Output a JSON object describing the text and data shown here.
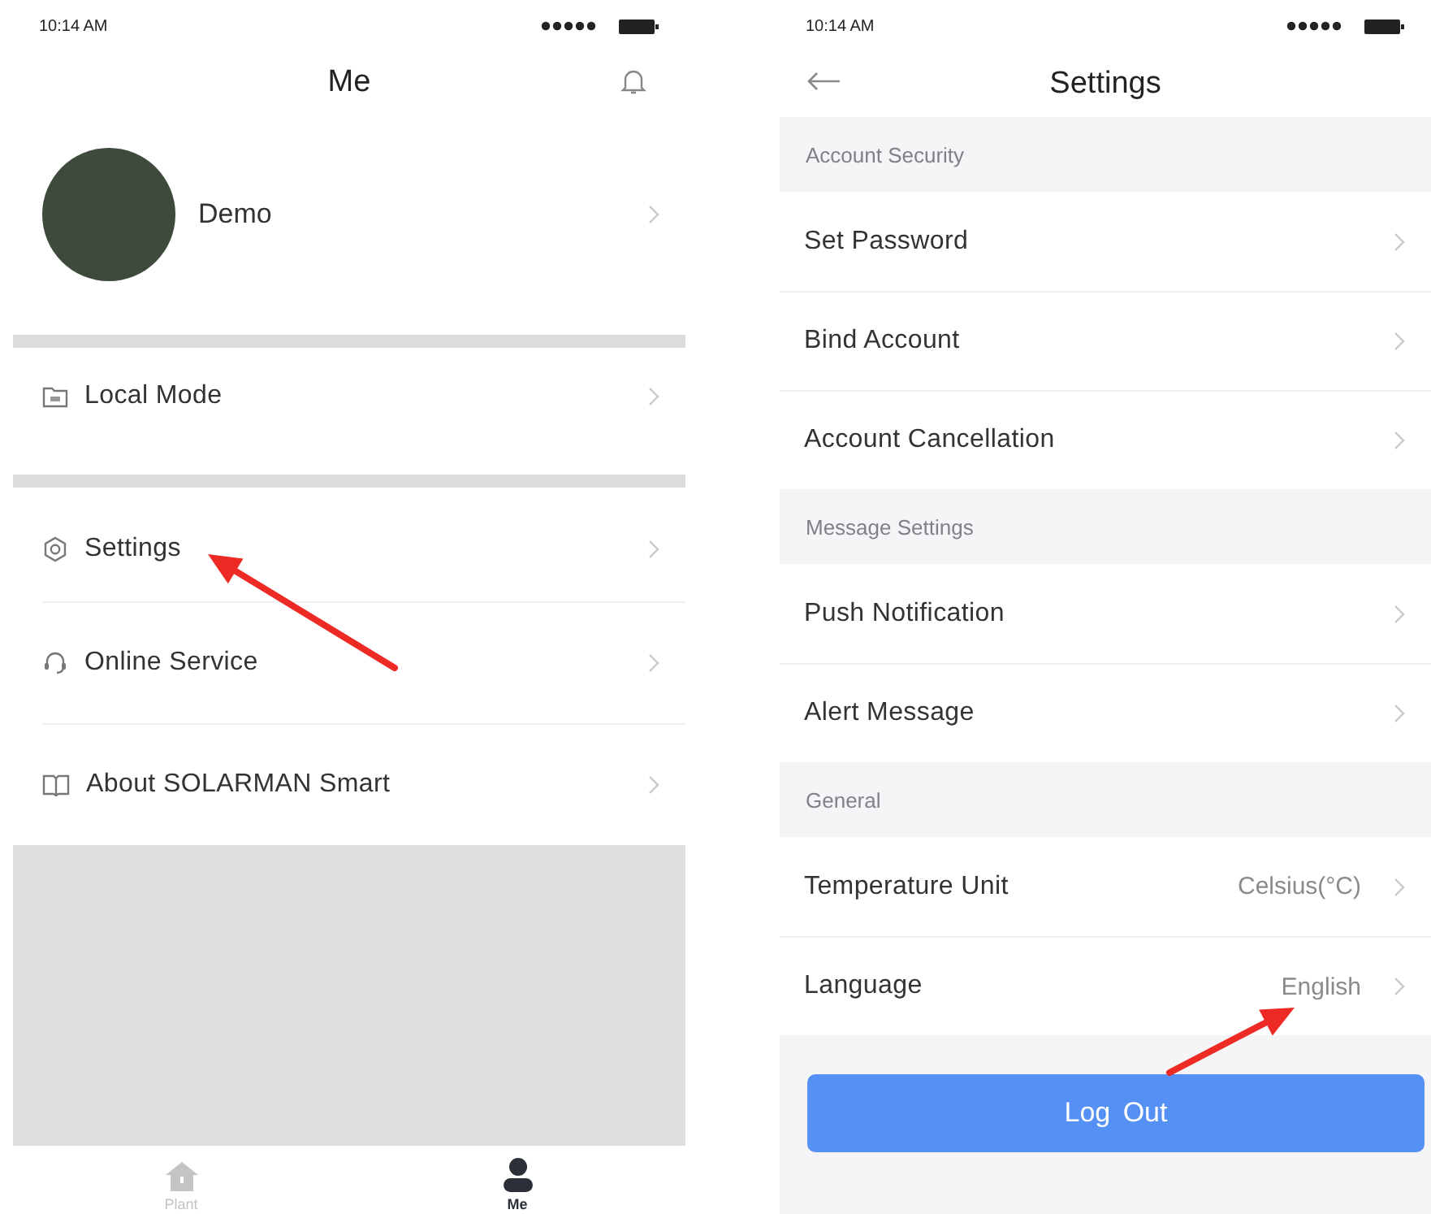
{
  "me_screen": {
    "status_bar": {
      "time": "10:14 AM"
    },
    "title": "Me",
    "profile": {
      "name": "Demo"
    },
    "groups": [
      [
        {
          "kind": "folder",
          "label": "Local Mode"
        }
      ],
      [
        {
          "kind": "gear",
          "label": "Settings"
        },
        {
          "kind": "headset",
          "label": "Online Service"
        },
        {
          "kind": "book",
          "label": "About SOLARMAN Smart"
        }
      ]
    ],
    "tabs": [
      {
        "kind": "house",
        "label": "Plant",
        "selected": false
      },
      {
        "kind": "person",
        "label": "Me",
        "selected": true
      }
    ]
  },
  "settings_screen": {
    "status_bar": {
      "time": "10:14 AM"
    },
    "title": "Settings",
    "sections": [
      {
        "title": "Account Security",
        "rows": [
          {
            "label": "Set Password"
          },
          {
            "label": "Bind Account"
          },
          {
            "label": "Account Cancellation"
          }
        ]
      },
      {
        "title": "Message Settings",
        "rows": [
          {
            "label": "Push Notification"
          },
          {
            "label": "Alert Message"
          }
        ]
      },
      {
        "title": "General",
        "rows": [
          {
            "label": "Temperature Unit",
            "value": "Celsius(°C)"
          },
          {
            "label": "Language",
            "value": "English"
          }
        ]
      }
    ],
    "logout_button": "Log Out"
  }
}
